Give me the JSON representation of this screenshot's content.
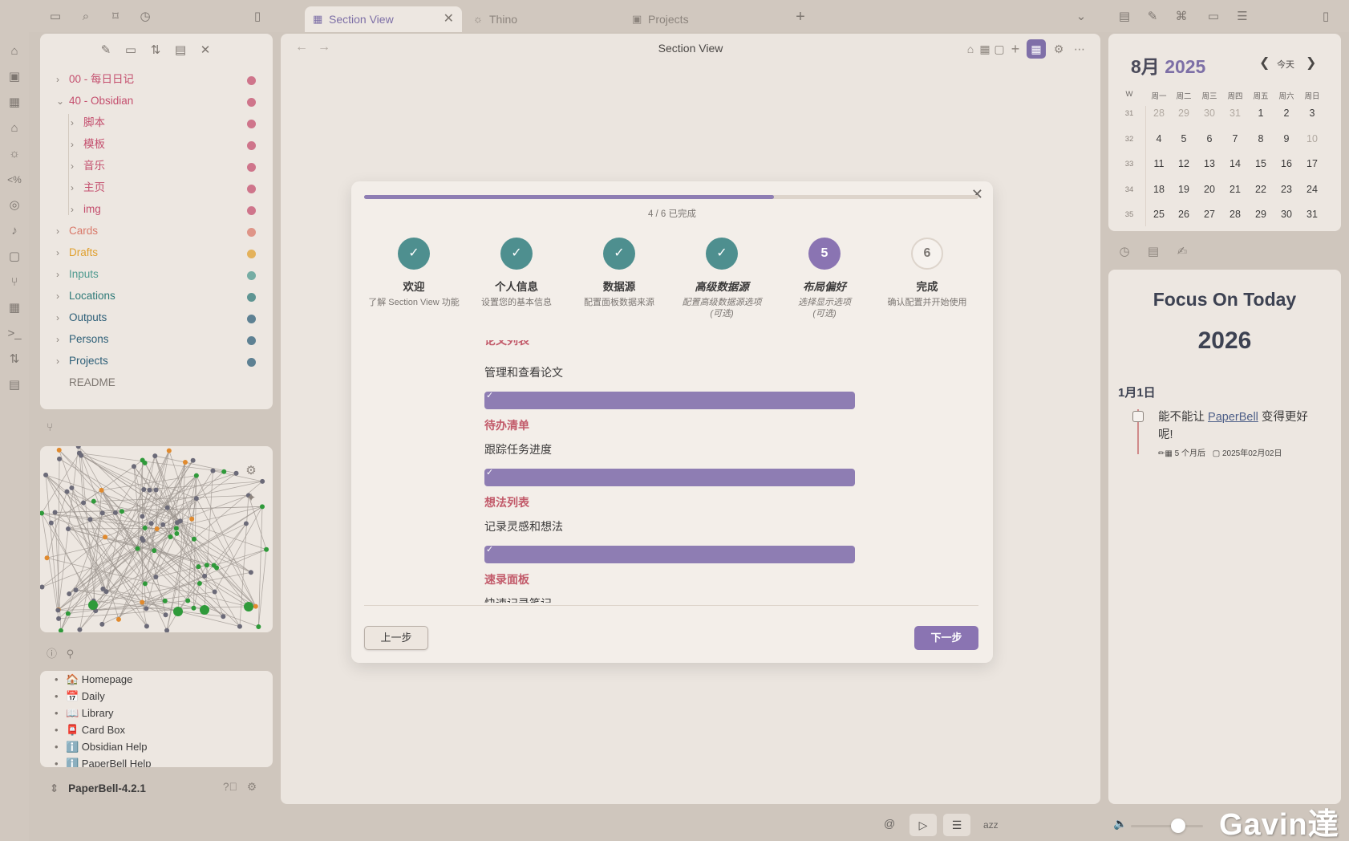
{
  "tabs": [
    {
      "label": "Section View",
      "icon": "grid-icon"
    },
    {
      "label": "Thino",
      "icon": "lightbulb-icon"
    },
    {
      "label": "Projects",
      "icon": "table-icon"
    }
  ],
  "main": {
    "title": "Section View"
  },
  "explorer": {
    "items": [
      {
        "label": "00 - 每日日记",
        "expanded": false,
        "color": "#c44f6e"
      },
      {
        "label": "40 - Obsidian",
        "expanded": true,
        "color": "#c44f6e"
      },
      {
        "label": "脚本",
        "color": "#c44f6e"
      },
      {
        "label": "模板",
        "color": "#c44f6e"
      },
      {
        "label": "音乐",
        "color": "#c44f6e"
      },
      {
        "label": "主页",
        "color": "#c44f6e"
      },
      {
        "label": "img",
        "color": "#c44f6e"
      },
      {
        "label": "Cards",
        "color": "#d9796a"
      },
      {
        "label": "Drafts",
        "color": "#e0a02e"
      },
      {
        "label": "Inputs",
        "color": "#4e9a8f"
      },
      {
        "label": "Locations",
        "color": "#2f7a78"
      },
      {
        "label": "Outputs",
        "color": "#2d5f78"
      },
      {
        "label": "Persons",
        "color": "#2d5f78"
      },
      {
        "label": "Projects",
        "color": "#2d5f78"
      },
      {
        "label": "README",
        "color": "#7d7670"
      }
    ]
  },
  "bookmarks": [
    "🏠 Homepage",
    "📅 Daily",
    "📖 Library",
    "📮 Card Box",
    "ℹ️ Obsidian Help",
    "ℹ️ PaperBell Help"
  ],
  "vault": {
    "name": "PaperBell-4.2.1"
  },
  "modal": {
    "progress_label": "4 / 6 已完成",
    "progress_fraction": 0.667,
    "steps": [
      {
        "number": "1",
        "title": "欢迎",
        "desc": "了解 Section View 功能",
        "state": "done"
      },
      {
        "number": "2",
        "title": "个人信息",
        "desc": "设置您的基本信息",
        "state": "done"
      },
      {
        "number": "3",
        "title": "数据源",
        "desc": "配置面板数据来源",
        "state": "done"
      },
      {
        "number": "4",
        "title": "高级数据源",
        "desc": "配置高级数据源选项",
        "desc2": "(可选)",
        "state": "done"
      },
      {
        "number": "5",
        "title": "布局偏好",
        "desc": "选择显示选项",
        "desc2": "(可选)",
        "state": "current"
      },
      {
        "number": "6",
        "title": "完成",
        "desc": "确认配置并开始使用",
        "state": "pending"
      }
    ],
    "sections": [
      {
        "title": "论文列表",
        "desc": "管理和查看论文"
      },
      {
        "title": "待办清单",
        "desc": "跟踪任务进度"
      },
      {
        "title": "想法列表",
        "desc": "记录灵感和想法"
      },
      {
        "title": "速录面板",
        "desc": "快速记录笔记"
      }
    ],
    "prev_label": "上一步",
    "next_label": "下一步"
  },
  "calendar": {
    "month": "8月",
    "year": "2025",
    "today_label": "今天",
    "week_header": "W",
    "day_headers": [
      "周一",
      "周二",
      "周三",
      "周四",
      "周五",
      "周六",
      "周日"
    ],
    "weeks": [
      {
        "num": "31",
        "days": [
          "28",
          "29",
          "30",
          "31",
          "1",
          "2",
          "3"
        ]
      },
      {
        "num": "32",
        "days": [
          "4",
          "5",
          "6",
          "7",
          "8",
          "9",
          "10"
        ]
      },
      {
        "num": "33",
        "days": [
          "11",
          "12",
          "13",
          "14",
          "15",
          "16",
          "17"
        ]
      },
      {
        "num": "34",
        "days": [
          "18",
          "19",
          "20",
          "21",
          "22",
          "23",
          "24"
        ]
      },
      {
        "num": "35",
        "days": [
          "25",
          "26",
          "27",
          "28",
          "29",
          "30",
          "31"
        ]
      }
    ]
  },
  "focus": {
    "title": "Focus On Today",
    "year": "2026",
    "date": "1月1日",
    "task_before": "能不能让 ",
    "task_link": "PaperBell",
    "task_after": " 变得更好呢!",
    "task_meta_1": "5 个月后",
    "task_meta_2": "2025年02月02日"
  },
  "status": {
    "text": "azz"
  },
  "watermark": "Gavin達"
}
